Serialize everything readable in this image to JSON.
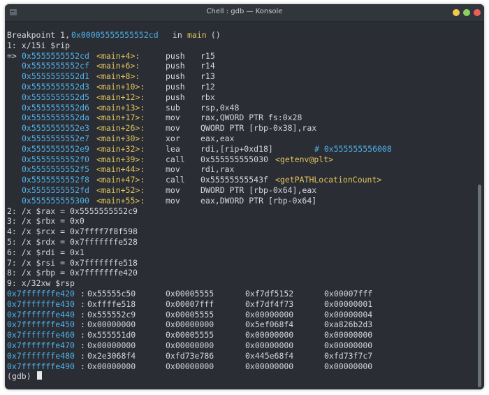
{
  "window": {
    "title": "Chell : gdb — Konsole"
  },
  "breakpoint": {
    "prefix": "Breakpoint 1, ",
    "addr": "0x00005555555552cd",
    "in": " in ",
    "func": "main",
    "args": " ()"
  },
  "cmd1": "1: x/15i $rip",
  "instr": [
    {
      "m": "=> ",
      "a": "0x5555555552cd",
      "s": "<main+4>:",
      "op": "push",
      "arg": "r15"
    },
    {
      "m": "",
      "a": "0x5555555552cf",
      "s": "<main+6>:",
      "op": "push",
      "arg": "r14"
    },
    {
      "m": "",
      "a": "0x5555555552d1",
      "s": "<main+8>:",
      "op": "push",
      "arg": "r13"
    },
    {
      "m": "",
      "a": "0x5555555552d3",
      "s": "<main+10>:",
      "op": "push",
      "arg": "r12"
    },
    {
      "m": "",
      "a": "0x5555555552d5",
      "s": "<main+12>:",
      "op": "push",
      "arg": "rbx"
    },
    {
      "m": "",
      "a": "0x5555555552d6",
      "s": "<main+13>:",
      "op": "sub",
      "arg": "rsp,0x48"
    },
    {
      "m": "",
      "a": "0x5555555552da",
      "s": "<main+17>:",
      "op": "mov",
      "arg": "rax,QWORD PTR fs:0x28"
    },
    {
      "m": "",
      "a": "0x5555555552e3",
      "s": "<main+26>:",
      "op": "mov",
      "arg": "QWORD PTR [rbp-0x38],rax"
    },
    {
      "m": "",
      "a": "0x5555555552e7",
      "s": "<main+30>:",
      "op": "xor",
      "arg": "eax,eax"
    },
    {
      "m": "",
      "a": "0x5555555552e9",
      "s": "<main+32>:",
      "op": "lea",
      "arg": "rdi,[rip+0xd18]",
      "c": "# 0x555555556008"
    },
    {
      "m": "",
      "a": "0x5555555552f0",
      "s": "<main+39>:",
      "op": "call",
      "arg": "0x555555555030",
      "t": "<getenv@plt>"
    },
    {
      "m": "",
      "a": "0x5555555552f5",
      "s": "<main+44>:",
      "op": "mov",
      "arg": "rdi,rax"
    },
    {
      "m": "",
      "a": "0x5555555552f8",
      "s": "<main+47>:",
      "op": "call",
      "arg": "0x55555555543f",
      "t": "<getPATHLocationCount>"
    },
    {
      "m": "",
      "a": "0x5555555552fd",
      "s": "<main+52>:",
      "op": "mov",
      "arg": "DWORD PTR [rbp-0x64],eax"
    },
    {
      "m": "",
      "a": "0x555555555300",
      "s": "<main+55>:",
      "op": "mov",
      "arg": "eax,DWORD PTR [rbp-0x64]"
    }
  ],
  "regs": [
    "2: /x $rax = 0x5555555552c9",
    "3: /x $rbx = 0x0",
    "4: /x $rcx = 0x7ffff7f8f598",
    "5: /x $rdx = 0x7fffffffe528",
    "6: /x $rdi = 0x1",
    "7: /x $rsi = 0x7fffffffe518",
    "8: /x $rbp = 0x7fffffffe420"
  ],
  "cmd9": "9: x/32xw $rsp",
  "mem": [
    {
      "a": "0x7fffffffe420",
      "v": [
        "0x55555c50",
        "0x00005555",
        "0xf7df5152",
        "0x00007fff"
      ]
    },
    {
      "a": "0x7fffffffe430",
      "v": [
        "0xffffe518",
        "0x00007fff",
        "0xf7df4f73",
        "0x00000001"
      ]
    },
    {
      "a": "0x7fffffffe440",
      "v": [
        "0x555552c9",
        "0x00005555",
        "0x00000000",
        "0x00000004"
      ]
    },
    {
      "a": "0x7fffffffe450",
      "v": [
        "0x00000000",
        "0x00000000",
        "0x5ef068f4",
        "0xa826b2d3"
      ]
    },
    {
      "a": "0x7fffffffe460",
      "v": [
        "0x555551d0",
        "0x00005555",
        "0x00000000",
        "0x00000000"
      ]
    },
    {
      "a": "0x7fffffffe470",
      "v": [
        "0x00000000",
        "0x00000000",
        "0x00000000",
        "0x00000000"
      ]
    },
    {
      "a": "0x7fffffffe480",
      "v": [
        "0x2e3068f4",
        "0xfd73e786",
        "0x445e68f4",
        "0xfd73f7c7"
      ]
    },
    {
      "a": "0x7fffffffe490",
      "v": [
        "0x00000000",
        "0x00000000",
        "0x00000000",
        "0x00000000"
      ]
    }
  ],
  "prompt": "(gdb) "
}
